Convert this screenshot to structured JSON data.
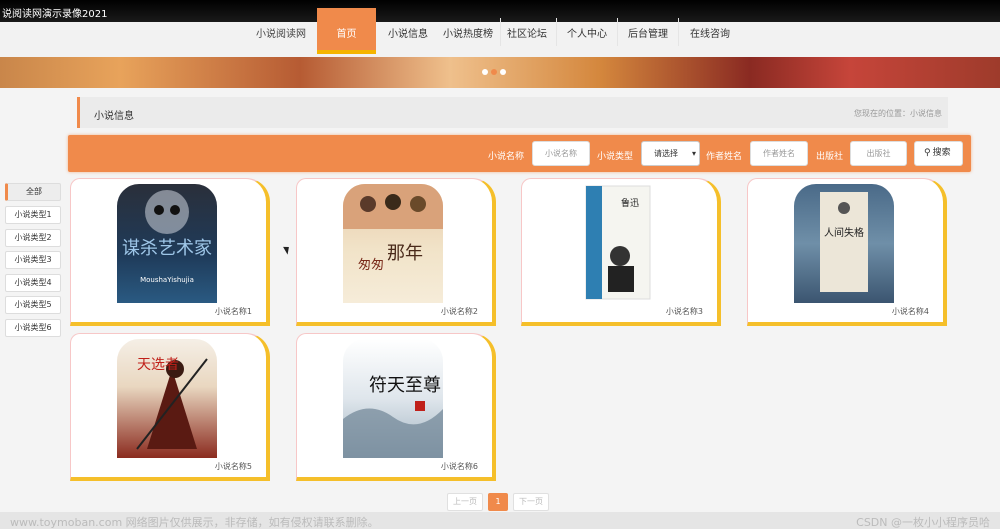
{
  "window": {
    "title": "说阅读网演示录像2021"
  },
  "nav": {
    "brand": "小说阅读网",
    "items": [
      {
        "label": "首页",
        "active": true
      },
      {
        "label": "小说信息",
        "active": false
      },
      {
        "label": "小说热度榜",
        "active": false
      },
      {
        "label": "社区论坛",
        "active": false
      },
      {
        "label": "个人中心",
        "active": false
      },
      {
        "label": "后台管理",
        "active": false
      },
      {
        "label": "在线咨询",
        "active": false
      }
    ]
  },
  "banner": {
    "dots": 3,
    "active_dot": 2
  },
  "page": {
    "title": "小说信息",
    "breadcrumb": "您现在的位置：小说信息"
  },
  "search": {
    "name_label": "小说名称",
    "name_placeholder": "小说名称",
    "type_label": "小说类型",
    "type_selected": "请选择",
    "author_label": "作者姓名",
    "author_placeholder": "作者姓名",
    "publisher_label": "出版社",
    "publisher_placeholder": "出版社",
    "button_label": "搜索"
  },
  "categories": [
    {
      "label": "全部",
      "active": true
    },
    {
      "label": "小说类型1",
      "active": false
    },
    {
      "label": "小说类型2",
      "active": false
    },
    {
      "label": "小说类型3",
      "active": false
    },
    {
      "label": "小说类型4",
      "active": false
    },
    {
      "label": "小说类型5",
      "active": false
    },
    {
      "label": "小说类型6",
      "active": false
    }
  ],
  "novels": [
    {
      "name": "小说名称1",
      "cover_text": "谋杀艺术家",
      "cover_sub": "MoushaYishujia",
      "cover_color": "#1f3b5a"
    },
    {
      "name": "小说名称2",
      "cover_text": "那年",
      "cover_sub": "匆匆",
      "cover_color": "#f1e3c8"
    },
    {
      "name": "小说名称3",
      "cover_text": "鲁迅",
      "cover_sub": "",
      "cover_color": "#2e7fb2"
    },
    {
      "name": "小说名称4",
      "cover_text": "人间失格",
      "cover_sub": "",
      "cover_color": "#6f8fa8"
    },
    {
      "name": "小说名称5",
      "cover_text": "天选者",
      "cover_sub": "",
      "cover_color": "#8b2b1f"
    },
    {
      "name": "小说名称6",
      "cover_text": "符天至尊",
      "cover_sub": "",
      "cover_color": "#aebcc7"
    }
  ],
  "pager": {
    "prev": "上一页",
    "current": "1",
    "next": "下一页"
  },
  "watermark": {
    "left": "www.toymoban.com 网络图片仅供展示，非存储，如有侵权请联系删除。",
    "right": "CSDN @一枚小小程序员哈"
  },
  "colors": {
    "accent": "#f08a4b",
    "accent2": "#f5bf2a"
  }
}
